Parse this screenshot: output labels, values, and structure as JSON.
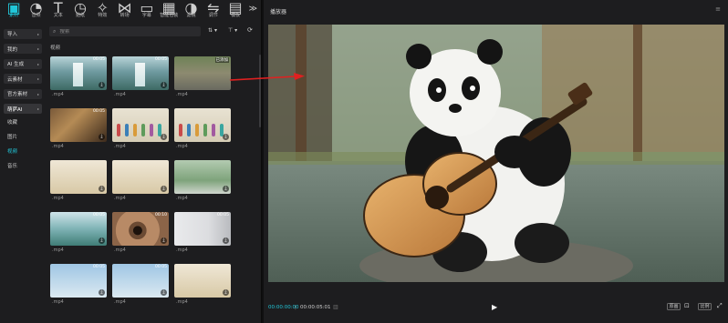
{
  "toolbar": {
    "tools": [
      {
        "label": "素材",
        "icon": "media-icon",
        "active": true
      },
      {
        "label": "音频",
        "icon": "audio-icon"
      },
      {
        "label": "文本",
        "icon": "text-icon"
      },
      {
        "label": "贴纸",
        "icon": "sticker-icon"
      },
      {
        "label": "特效",
        "icon": "effects-icon"
      },
      {
        "label": "转场",
        "icon": "transition-icon"
      },
      {
        "label": "字幕",
        "icon": "subtitle-icon"
      },
      {
        "label": "智能包装",
        "icon": "smart-pack-icon"
      },
      {
        "label": "滤镜",
        "icon": "filter-icon"
      },
      {
        "label": "调节",
        "icon": "adjust-icon"
      },
      {
        "label": "模板",
        "icon": "template-icon"
      }
    ],
    "more": "≫"
  },
  "sidebar": {
    "buttons": [
      {
        "label": "导入"
      },
      {
        "label": "我的"
      },
      {
        "label": "AI 生成"
      },
      {
        "label": "云素材"
      },
      {
        "label": "官方素材"
      },
      {
        "label": "萌萨AI",
        "active": true
      }
    ],
    "links": [
      {
        "label": "收藏"
      },
      {
        "label": "图片"
      },
      {
        "label": "视频",
        "active": true
      },
      {
        "label": "音乐"
      }
    ]
  },
  "search": {
    "placeholder": "搜索"
  },
  "sort_icon_text": "⇅",
  "filter_icon_text": "⊤",
  "section_title": "视频",
  "media": [
    {
      "art": "art-waterfall",
      "duration": "00:05",
      "caption": ".mp4",
      "download": true
    },
    {
      "art": "art-waterfall",
      "duration": "00:05",
      "caption": ".mp4",
      "download": true
    },
    {
      "art": "art-panda-s",
      "tag": "已添加",
      "caption": ".mp4",
      "download": false
    },
    {
      "art": "art-painting",
      "duration": "00:05",
      "caption": ".mp4",
      "download": true
    },
    {
      "art": "art-scroll",
      "duration": "",
      "caption": ".mp4",
      "download": true
    },
    {
      "art": "art-scroll",
      "duration": "",
      "caption": ".mp4",
      "download": true
    },
    {
      "art": "art-scroll2",
      "duration": "",
      "caption": ".mp4",
      "download": true
    },
    {
      "art": "art-scroll2",
      "duration": "",
      "caption": ".mp4",
      "download": true
    },
    {
      "art": "art-run",
      "duration": "",
      "caption": ".mp4",
      "download": true
    },
    {
      "art": "art-mtn",
      "duration": "00:05",
      "caption": ".mp4",
      "download": true
    },
    {
      "art": "art-eye",
      "duration": "00:10",
      "caption": ".mp4",
      "download": true
    },
    {
      "art": "art-room",
      "duration": "00:05",
      "caption": ".mp4",
      "download": true
    },
    {
      "art": "art-cartoon",
      "duration": "00:05",
      "caption": ".mp4",
      "download": true
    },
    {
      "art": "art-cartoon",
      "duration": "00:05",
      "caption": ".mp4",
      "download": true
    },
    {
      "art": "art-scroll2",
      "duration": "",
      "caption": ".mp4",
      "download": true
    }
  ],
  "player": {
    "title": "播放器",
    "menu": "≡",
    "current_time": "00:00:00:00",
    "separator": "|",
    "total_time": "00:00:05:01",
    "play": "▶",
    "btn_original": "原画",
    "btn_ratio": "比例"
  },
  "colors": {
    "accent": "#21c7d9",
    "arrow": "#e02020"
  }
}
